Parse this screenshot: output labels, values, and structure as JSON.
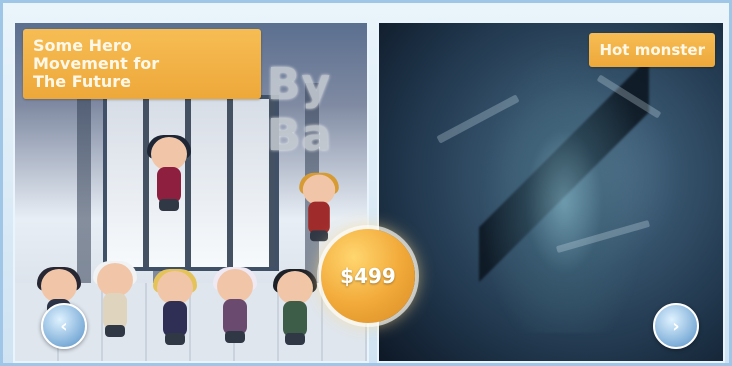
{
  "left_panel": {
    "title_lines": [
      "Some Hero",
      "Movement for",
      "The Future"
    ],
    "background_text": "By Ba"
  },
  "right_panel": {
    "tag": "Hot monster"
  },
  "price_button": {
    "label": "$499"
  },
  "controls": {
    "left_icon": "chevron-left-icon",
    "right_icon": "chevron-right-icon"
  },
  "colors": {
    "accent": "#eea83a",
    "frame": "#9fc6e6",
    "nav": "#4f89bf"
  }
}
